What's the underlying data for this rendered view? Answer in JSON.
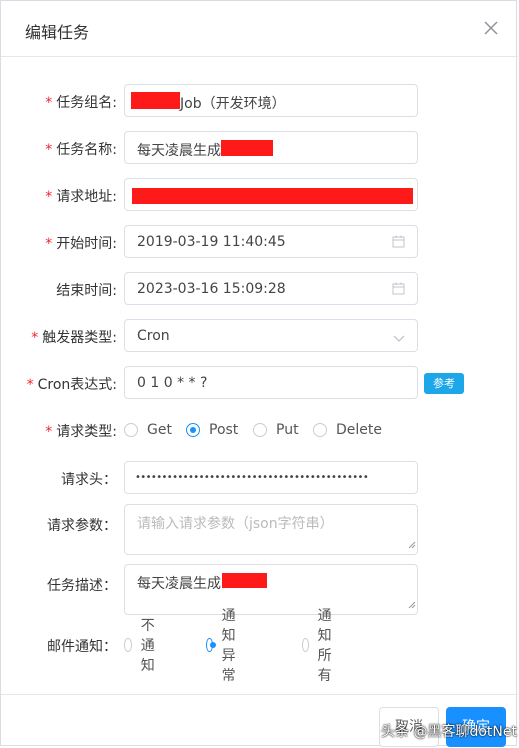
{
  "dialog": {
    "title": "编辑任务"
  },
  "form": {
    "group": {
      "label": "任务组名:",
      "required": true,
      "value_suffix": "Job（开发环境）"
    },
    "name": {
      "label": "任务名称:",
      "required": true,
      "value": "每天凌晨生成"
    },
    "url": {
      "label": "请求地址:",
      "required": true
    },
    "start_time": {
      "label": "开始时间:",
      "required": true,
      "value": "2019-03-19 11:40:45"
    },
    "end_time": {
      "label": "结束时间:",
      "required": false,
      "value": "2023-03-16 15:09:28"
    },
    "trigger_type": {
      "label": "触发器类型:",
      "required": true,
      "value": "Cron"
    },
    "cron": {
      "label": "Cron表达式:",
      "required": true,
      "value": "0 1 0 * * ?",
      "ref_button": "参考"
    },
    "request_type": {
      "label": "请求类型:",
      "required": true,
      "options": [
        "Get",
        "Post",
        "Put",
        "Delete"
      ],
      "selected": "Post"
    },
    "headers": {
      "label": "请求头：",
      "value": "••••••••••••••••••••••••••••••••••••••••••••"
    },
    "params": {
      "label": "请求参数：",
      "placeholder": "请输入请求参数（json字符串）"
    },
    "description": {
      "label": "任务描述：",
      "value": "每天凌晨生成"
    },
    "mail_notify": {
      "label": "邮件通知：",
      "options": [
        "不通知",
        "通知异常",
        "通知所有"
      ],
      "selected": "通知异常"
    }
  },
  "footer": {
    "cancel_label": "取消",
    "confirm_label": "确定"
  },
  "watermark": "头条 @黑客聊dotNet",
  "colors": {
    "required": "#f5222d",
    "primary": "#1890ff",
    "ref_button": "#1ea7e8",
    "redaction": "#ff1a1a"
  }
}
